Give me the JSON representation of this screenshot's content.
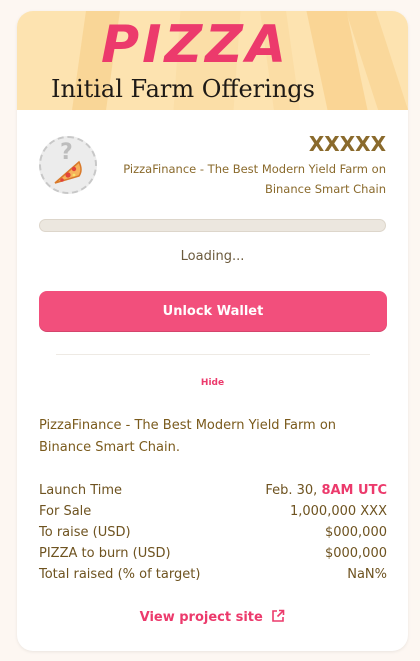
{
  "banner": {
    "brand": "PIZZA",
    "title": "Initial Farm Offerings"
  },
  "token": {
    "icon": "pizza-placeholder-icon",
    "name": "XXXXX",
    "description": "PizzaFinance - The Best Modern Yield Farm on Binance Smart Chain"
  },
  "progress": {
    "fraction": 0,
    "status": "Loading..."
  },
  "actions": {
    "unlock_label": "Unlock Wallet",
    "hide_label": "Hide",
    "view_site_label": "View project site",
    "view_site_icon": "external-link-icon"
  },
  "about": "PizzaFinance - The Best Modern Yield Farm on Binance Smart Chain.",
  "details": {
    "launch_time_label": "Launch Time",
    "launch_date": "Feb. 30,",
    "launch_hour": "8AM UTC",
    "for_sale_label": "For Sale",
    "for_sale_value": "1,000,000 XXX",
    "to_raise_label": "To raise (USD)",
    "to_raise_value": "$000,000",
    "burn_label": "PIZZA to burn (USD)",
    "burn_value": "$000,000",
    "total_raised_label": "Total raised (% of target)",
    "total_raised_value": "NaN%"
  },
  "colors": {
    "accent": "#ec3a6c",
    "button": "#f24f7c",
    "text_brown": "#8a6a2c",
    "banner_bg": "#fde3b0"
  }
}
